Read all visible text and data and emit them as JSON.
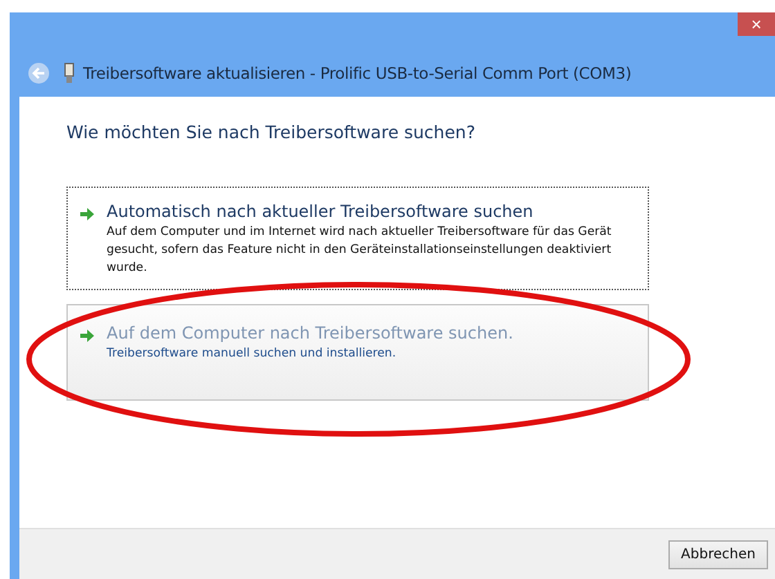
{
  "window": {
    "title": "Treibersoftware aktualisieren - Prolific USB-to-Serial Comm Port (COM3)",
    "close": "×"
  },
  "heading": "Wie möchten Sie nach Treibersoftware suchen?",
  "options": [
    {
      "title": "Automatisch nach aktueller Treibersoftware suchen",
      "description": "Auf dem Computer und im Internet wird nach aktueller Treibersoftware für das Gerät gesucht, sofern das Feature nicht in den Geräteinstallationseinstellungen deaktiviert wurde.",
      "focused": true,
      "hovered": false
    },
    {
      "title": "Auf dem Computer nach Treibersoftware suchen.",
      "description": "Treibersoftware manuell suchen und installieren.",
      "focused": false,
      "hovered": true
    }
  ],
  "annotation": {
    "kind": "ellipse"
  },
  "buttons": [
    "Abbrechen"
  ]
}
